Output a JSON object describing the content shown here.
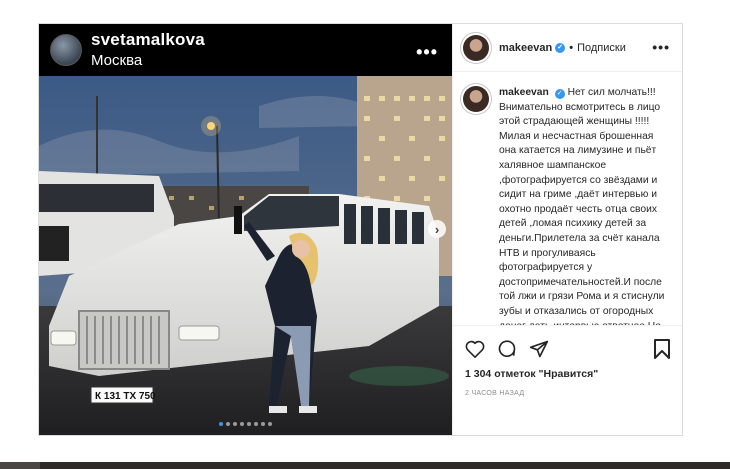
{
  "media": {
    "username": "svetamalkova",
    "location": "Москва",
    "more_icon": "more-horizontal-icon",
    "plate": "К 131 ТХ 750",
    "carousel": {
      "total": 8,
      "active": 0
    }
  },
  "side": {
    "username": "makeevan",
    "verified_icon": "verified-badge-icon",
    "separator": "•",
    "follow_label": "Подписки",
    "more_icon": "more-horizontal-icon"
  },
  "caption": {
    "username": "makeevan",
    "text": "Нет сил молчать!!!\nВнимательно всмотритесь в лицо этой страдающей женщины !!!!!\nМилая и несчастная брошенная она катается на лимузине и пьёт халявное шампанское ,фотографируется со звёздами и сидит на гриме ,даёт интервью и охотно продаёт честь отца своих детей ,ломая психику детей за деньги.Прилетела за счёт канала НТВ и прогуливаясь фотографируется у достопримечательностей.И после той лжи и грязи Рома и я стиснули зубы и отказались от огородных денег дать интервью ответное.Но ....всему наступает предел и вот он наступил.Наша девушка почувствовала вкус денег и славы и поехала зарабатывать и плакать теперь на первый канал в «Пусть говоря» ,продолжая поливать"
  },
  "actions": {
    "like_icon": "heart-icon",
    "comment_icon": "comment-icon",
    "share_icon": "share-icon",
    "save_icon": "bookmark-icon",
    "likes_text": "1 304 отметок \"Нравится\"",
    "timestamp": "2 часов назад"
  },
  "colors": {
    "accent": "#3897f0",
    "text": "#262626",
    "muted": "#8e8e8e",
    "border": "#dbdbdb"
  }
}
